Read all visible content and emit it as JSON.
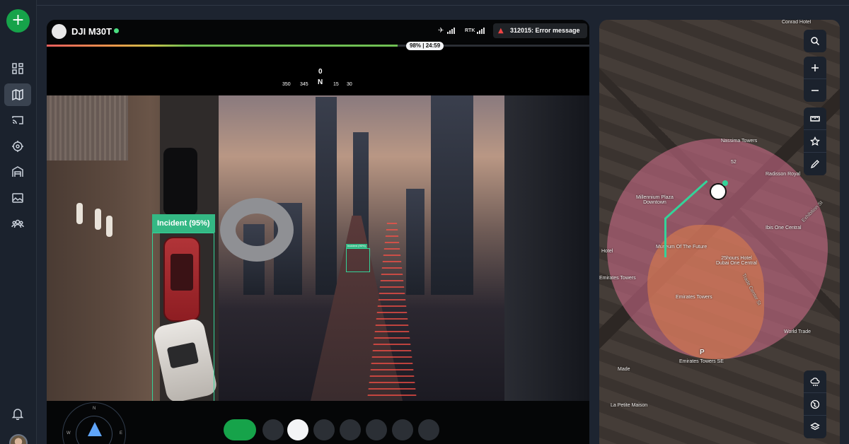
{
  "sidebar": {
    "add_label": "+",
    "items": [
      {
        "name": "dashboard",
        "icon": "grid-icon",
        "active": false
      },
      {
        "name": "map",
        "icon": "map-icon",
        "active": true
      },
      {
        "name": "cast",
        "icon": "cast-icon",
        "active": false
      },
      {
        "name": "target",
        "icon": "crosshair-icon",
        "active": false
      },
      {
        "name": "hangar",
        "icon": "garage-icon",
        "active": false
      },
      {
        "name": "media",
        "icon": "gallery-icon",
        "active": false
      },
      {
        "name": "team",
        "icon": "users-icon",
        "active": false
      }
    ],
    "bottom": {
      "notifications_icon": "bell-icon",
      "avatar_icon": "user-avatar"
    }
  },
  "video": {
    "drone_name": "DJI M30T",
    "status_color": "#4ade80",
    "rtk_label": "RTK",
    "error": {
      "code": "312015",
      "message": "Error message",
      "text": "312015: Error message"
    },
    "battery": {
      "percent": 98,
      "label": "98% | 24:59"
    },
    "compass": {
      "heading_deg": "0",
      "heading_dir": "N",
      "ticks": [
        "350",
        "345",
        "15",
        "30"
      ]
    },
    "incident": {
      "label": "Incident (95%)"
    },
    "small_detection_label": "Incident (95%)",
    "mini_compass_labels": [
      "N",
      "W",
      "E"
    ]
  },
  "map": {
    "labels": {
      "millennium": "Millennium Plaza\nDowntown",
      "museum": "Museum Of The Future",
      "hotel": "25hours Hotel\nDubai One Central",
      "emirates": "Emirates Towers",
      "emirates_left": "Emirates Towers",
      "emirates_se": "Emirates Towers SE",
      "ibis": "Ibis One Central",
      "radisson": "Radisson Royal",
      "nassima": "Nassima Towers",
      "conrad": "Conrad Hotel",
      "lapetite": "La Petite Maison",
      "trade_st": "Trade Center St",
      "exhibition": "Exhibition St",
      "road_52": "52",
      "hotel_short": "Hotel",
      "madea": "Made",
      "wtc": "World Trade",
      "p": "P"
    },
    "accent": "#34d399",
    "zone_color": "#d6708e",
    "controls": [
      "search-icon",
      "zoom-in-icon",
      "zoom-out-icon",
      "ruler-icon",
      "star-icon",
      "pencil-icon",
      "weather-icon",
      "globe-icon",
      "layers-icon"
    ]
  }
}
